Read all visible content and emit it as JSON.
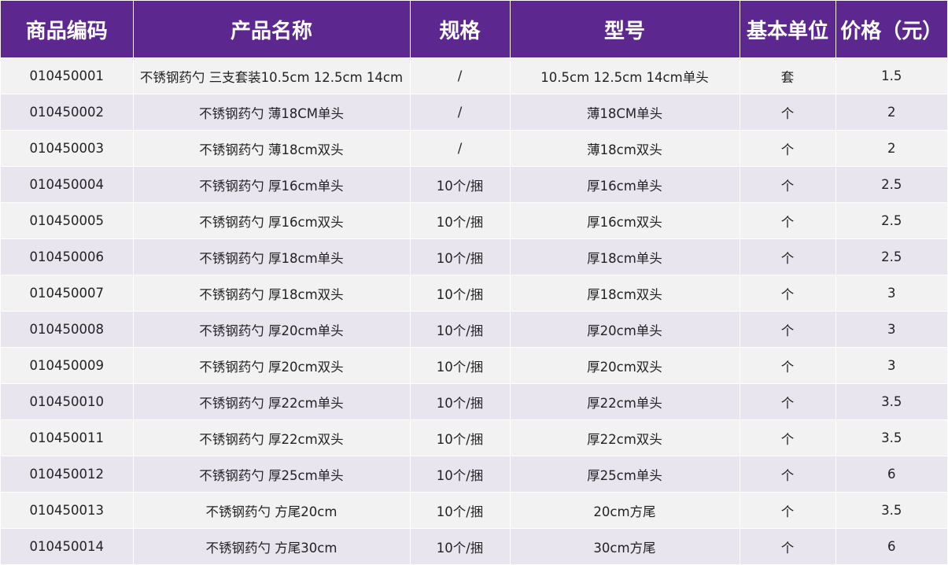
{
  "headers": [
    "商品编码",
    "产品名称",
    "规格",
    "型号",
    "基本单位",
    "价格（元）"
  ],
  "rows": [
    [
      "010450001",
      "不锈钢药勺 三支套装10.5cm 12.5cm 14cm",
      "/",
      "10.5cm 12.5cm 14cm单头",
      "套",
      "1.5"
    ],
    [
      "010450002",
      "不锈钢药勺 薄18CM单头",
      "/",
      "薄18CM单头",
      "个",
      "2"
    ],
    [
      "010450003",
      "不锈钢药勺 薄18cm双头",
      "/",
      "薄18cm双头",
      "个",
      "2"
    ],
    [
      "010450004",
      "不锈钢药勺 厚16cm单头",
      "10个/捆",
      "厚16cm单头",
      "个",
      "2.5"
    ],
    [
      "010450005",
      "不锈钢药勺 厚16cm双头",
      "10个/捆",
      "厚16cm双头",
      "个",
      "2.5"
    ],
    [
      "010450006",
      "不锈钢药勺 厚18cm单头",
      "10个/捆",
      "厚18cm单头",
      "个",
      "2.5"
    ],
    [
      "010450007",
      "不锈钢药勺 厚18cm双头",
      "10个/捆",
      "厚18cm双头",
      "个",
      "3"
    ],
    [
      "010450008",
      "不锈钢药勺 厚20cm单头",
      "10个/捆",
      "厚20cm单头",
      "个",
      "3"
    ],
    [
      "010450009",
      "不锈钢药勺 厚20cm双头",
      "10个/捆",
      "厚20cm双头",
      "个",
      "3"
    ],
    [
      "010450010",
      "不锈钢药勺 厚22cm单头",
      "10个/捆",
      "厚22cm单头",
      "个",
      "3.5"
    ],
    [
      "010450011",
      "不锈钢药勺 厚22cm双头",
      "10个/捆",
      "厚22cm双头",
      "个",
      "3.5"
    ],
    [
      "010450012",
      "不锈钢药勺 厚25cm单头",
      "10个/捆",
      "厚25cm单头",
      "个",
      "6"
    ],
    [
      "010450013",
      "不锈钢药勺 方尾20cm",
      "10个/捆",
      "20cm方尾",
      "个",
      "3.5"
    ],
    [
      "010450014",
      "不锈钢药勺 方尾30cm",
      "10个/捆",
      "30cm方尾",
      "个",
      "6"
    ]
  ],
  "colors": {
    "header_bg": "#5c2890",
    "row_odd": "#f2f2f2",
    "row_even": "#e8e5ef"
  }
}
